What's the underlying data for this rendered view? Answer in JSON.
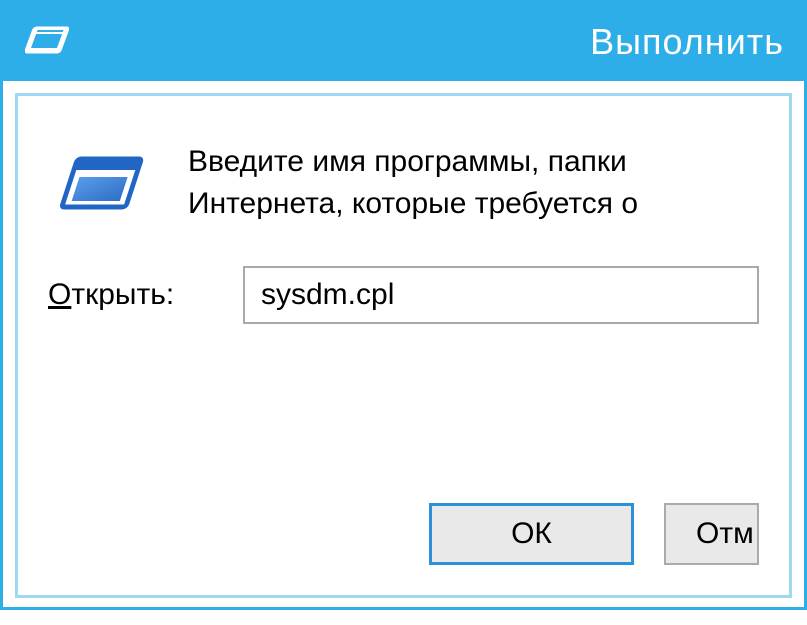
{
  "titlebar": {
    "title": "Выполнить"
  },
  "content": {
    "description_line1": "Введите имя программы, папки",
    "description_line2": "Интернета, которые требуется о",
    "open_label_underline": "О",
    "open_label_rest": "ткрыть:",
    "open_value": "sysdm.cpl"
  },
  "buttons": {
    "ok": "ОК",
    "cancel": "Отм"
  }
}
